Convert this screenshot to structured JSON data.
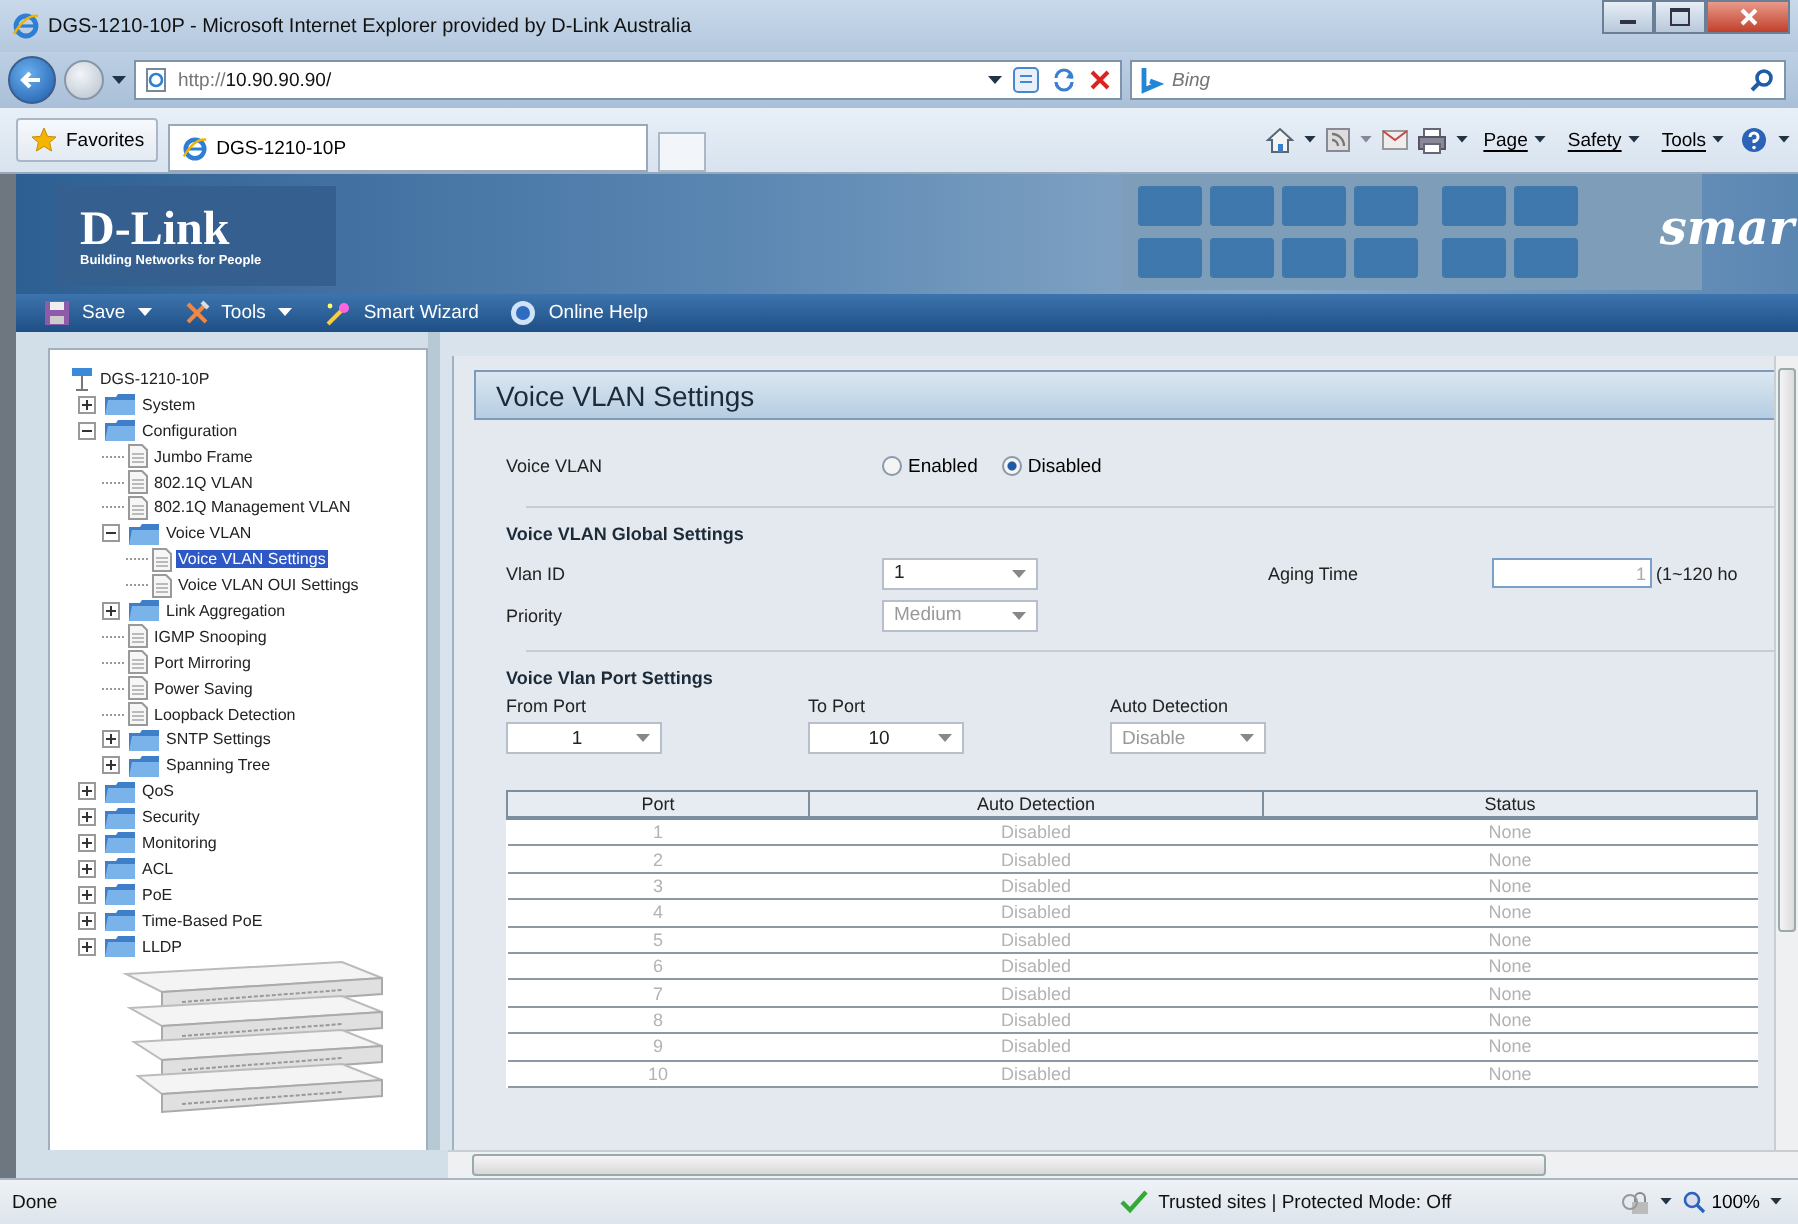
{
  "window": {
    "title": "DGS-1210-10P - Microsoft Internet Explorer provided by D-Link Australia"
  },
  "address_bar": {
    "url_prefix": "http://",
    "url_host": "10.90.90.90/",
    "search_placeholder": "Bing"
  },
  "favorites_bar": {
    "favorites": "Favorites",
    "tab": "DGS-1210-10P",
    "commands": [
      "Page",
      "Safety",
      "Tools"
    ]
  },
  "banner": {
    "logo": "D-Link",
    "tagline": "Building Networks for People",
    "brand": "smar"
  },
  "menu": [
    {
      "label": "Save",
      "kind": "save",
      "dropdown": true
    },
    {
      "label": "Tools",
      "kind": "tools",
      "dropdown": true
    },
    {
      "label": "Smart Wizard",
      "kind": "wizard",
      "dropdown": false
    },
    {
      "label": "Online Help",
      "kind": "help",
      "dropdown": false
    }
  ],
  "tree": {
    "label": "DGS-1210-10P",
    "kind": "device",
    "selected": false,
    "children": [
      {
        "label": "System",
        "kind": "folder",
        "expanded": false,
        "selected": false
      },
      {
        "label": "Configuration",
        "kind": "folder",
        "expanded": true,
        "selected": false,
        "children": [
          {
            "label": "Jumbo Frame",
            "kind": "page",
            "selected": false
          },
          {
            "label": "802.1Q VLAN",
            "kind": "page",
            "selected": false
          },
          {
            "label": "802.1Q Management VLAN",
            "kind": "page",
            "selected": false
          },
          {
            "label": "Voice VLAN",
            "kind": "folder",
            "expanded": true,
            "selected": false,
            "children": [
              {
                "label": "Voice VLAN Settings",
                "kind": "page",
                "selected": true
              },
              {
                "label": "Voice VLAN OUI Settings",
                "kind": "page",
                "selected": false
              }
            ]
          },
          {
            "label": "Link Aggregation",
            "kind": "folder",
            "expanded": false,
            "selected": false
          },
          {
            "label": "IGMP Snooping",
            "kind": "page",
            "selected": false
          },
          {
            "label": "Port Mirroring",
            "kind": "page",
            "selected": false
          },
          {
            "label": "Power Saving",
            "kind": "page",
            "selected": false
          },
          {
            "label": "Loopback Detection",
            "kind": "page",
            "selected": false
          },
          {
            "label": "SNTP Settings",
            "kind": "folder",
            "expanded": false,
            "selected": false
          },
          {
            "label": "Spanning Tree",
            "kind": "folder",
            "expanded": false,
            "selected": false
          }
        ]
      },
      {
        "label": "QoS",
        "kind": "folder",
        "expanded": false,
        "selected": false
      },
      {
        "label": "Security",
        "kind": "folder",
        "expanded": false,
        "selected": false
      },
      {
        "label": "Monitoring",
        "kind": "folder",
        "expanded": false,
        "selected": false
      },
      {
        "label": "ACL",
        "kind": "folder",
        "expanded": false,
        "selected": false
      },
      {
        "label": "PoE",
        "kind": "folder",
        "expanded": false,
        "selected": false
      },
      {
        "label": "Time-Based PoE",
        "kind": "folder",
        "expanded": false,
        "selected": false
      },
      {
        "label": "LLDP",
        "kind": "folder",
        "expanded": false,
        "selected": false
      }
    ]
  },
  "panel": {
    "title": "Voice VLAN Settings",
    "voice_vlan": {
      "label": "Voice VLAN",
      "options": [
        {
          "label": "Enabled",
          "selected": false
        },
        {
          "label": "Disabled",
          "selected": true
        }
      ]
    },
    "global": {
      "heading": "Voice VLAN Global Settings",
      "vlan_id": {
        "label": "Vlan ID",
        "value": "1",
        "disabled": false
      },
      "priority": {
        "label": "Priority",
        "value": "Medium",
        "disabled": true
      },
      "aging_time": {
        "label": "Aging Time",
        "value": "1",
        "hint": "(1~120 ho"
      }
    },
    "port_settings": {
      "heading": "Voice Vlan Port Settings",
      "fields": [
        {
          "label": "From Port",
          "value": "1",
          "disabled": false,
          "centered": true
        },
        {
          "label": "To Port",
          "value": "10",
          "disabled": false,
          "centered": true
        },
        {
          "label": "Auto Detection",
          "value": "Disable",
          "disabled": true,
          "centered": false
        }
      ]
    },
    "table": {
      "columns": [
        "Port",
        "Auto Detection",
        "Status"
      ],
      "rows": [
        [
          "1",
          "Disabled",
          "None"
        ],
        [
          "2",
          "Disabled",
          "None"
        ],
        [
          "3",
          "Disabled",
          "None"
        ],
        [
          "4",
          "Disabled",
          "None"
        ],
        [
          "5",
          "Disabled",
          "None"
        ],
        [
          "6",
          "Disabled",
          "None"
        ],
        [
          "7",
          "Disabled",
          "None"
        ],
        [
          "8",
          "Disabled",
          "None"
        ],
        [
          "9",
          "Disabled",
          "None"
        ],
        [
          "10",
          "Disabled",
          "None"
        ]
      ]
    }
  },
  "status_bar": {
    "text": "Done",
    "zone": "Trusted sites | Protected Mode: Off",
    "zoom": "100%"
  }
}
